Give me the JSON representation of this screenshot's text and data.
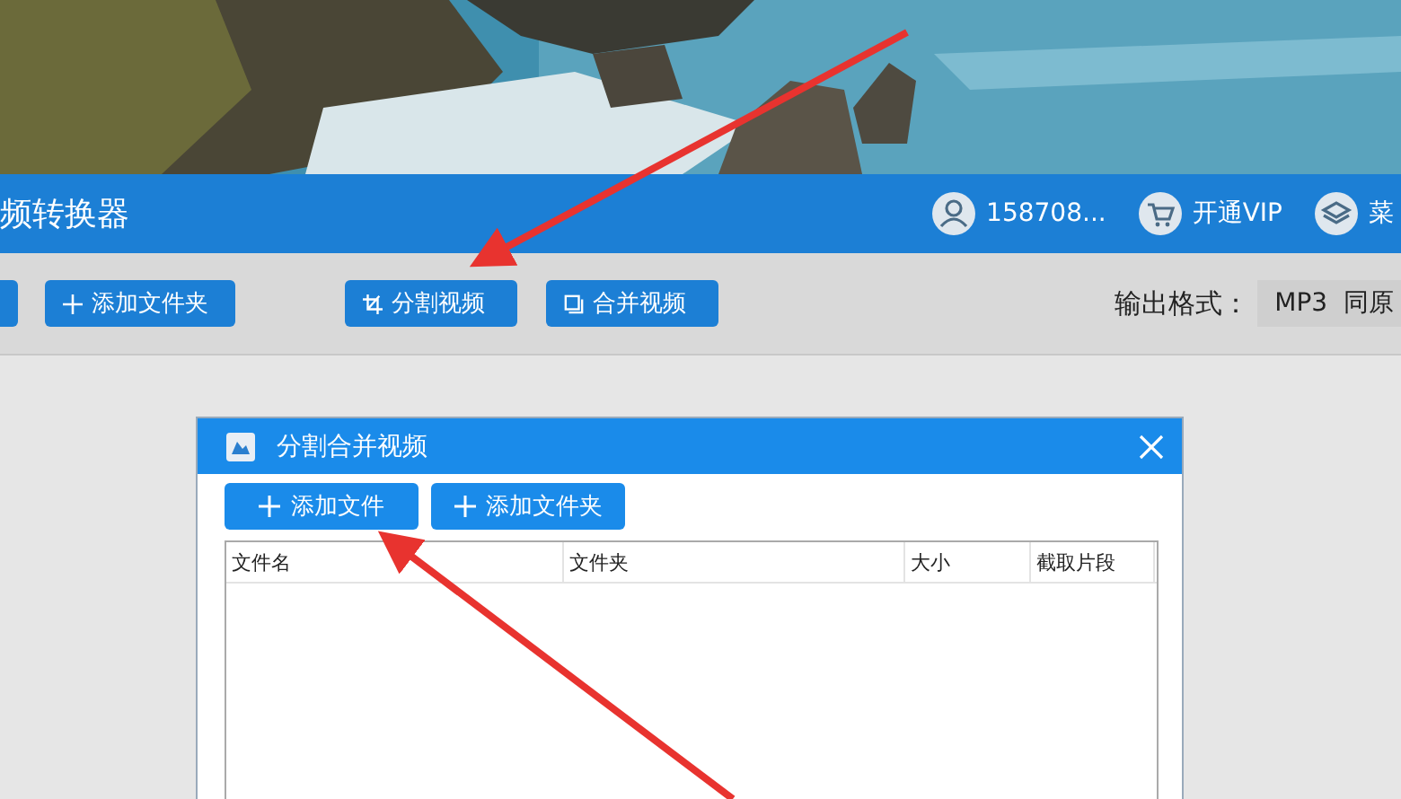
{
  "header": {
    "title": "频转换器",
    "user": "158708...",
    "vip": "开通VIP",
    "menu": "菜"
  },
  "toolbar": {
    "buttons": [
      {
        "kind": "cut"
      },
      {
        "kind": "plus",
        "label": "添加文件夹"
      },
      {
        "kind": "split",
        "label": "分割视频"
      },
      {
        "kind": "merge",
        "label": "合并视频"
      }
    ],
    "format_label": "输出格式：",
    "format_value": "MP3  同原"
  },
  "dialog": {
    "title": "分割合并视频",
    "buttons": [
      {
        "label": "添加文件"
      },
      {
        "label": "添加文件夹"
      }
    ],
    "table": {
      "columns": [
        "文件名",
        "文件夹",
        "大小",
        "截取片段"
      ]
    }
  }
}
